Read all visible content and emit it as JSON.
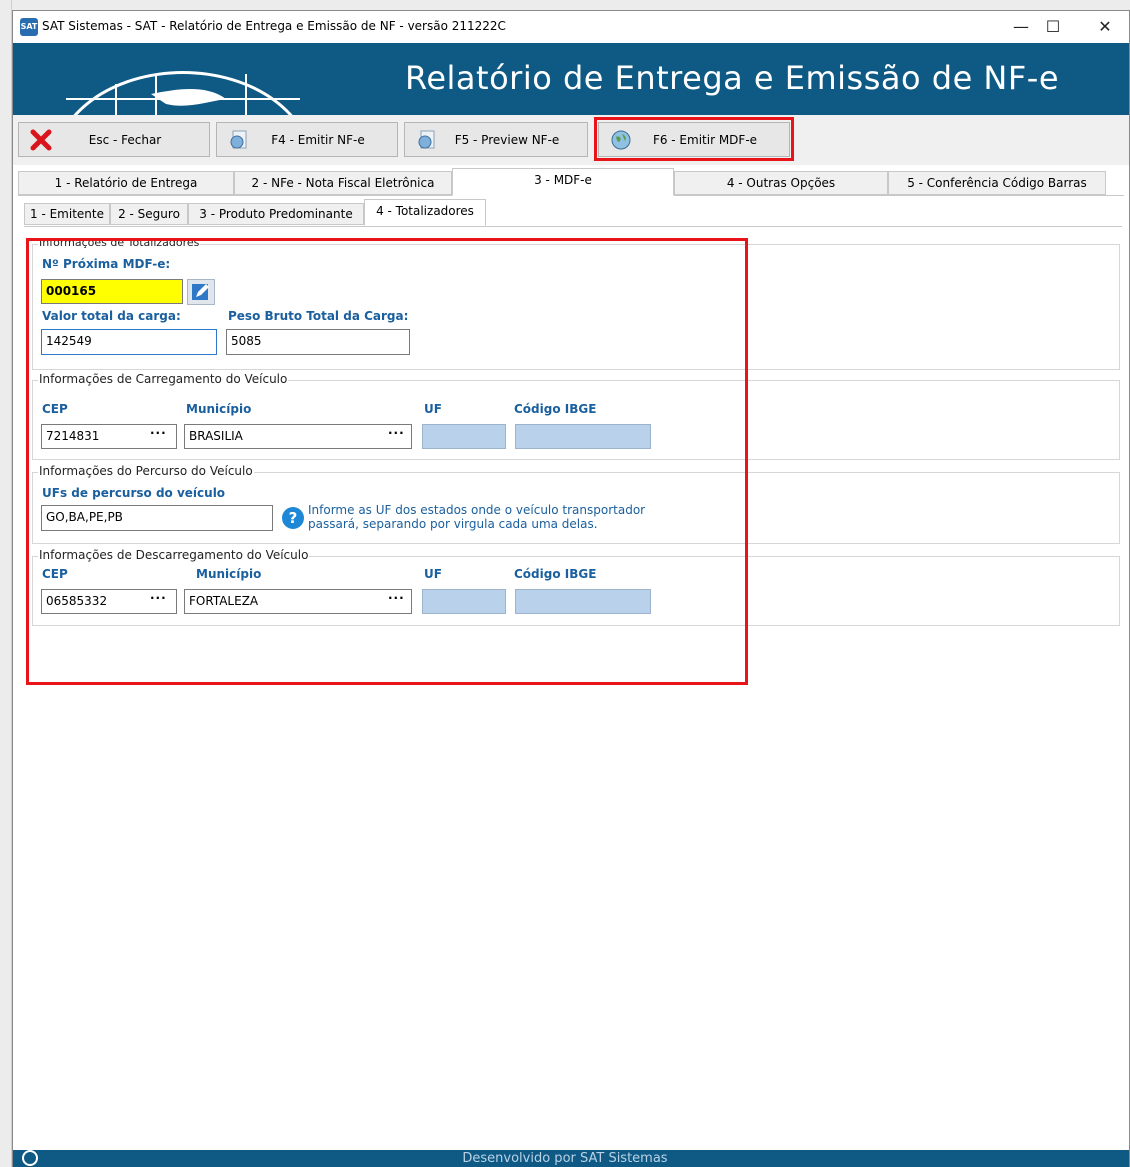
{
  "window": {
    "title": "SAT Sistemas - SAT - Relatório de Entrega e Emissão de NF - versão 211222C",
    "app_icon": "SAT"
  },
  "banner": {
    "title": "Relatório de Entrega e Emissão de NF-e"
  },
  "toolbar": {
    "close_label": "Esc - Fechar",
    "emit_nfe_label": "F4 - Emitir NF-e",
    "preview_nfe_label": "F5 - Preview NF-e",
    "emit_mdfe_label": "F6 - Emitir MDF-e"
  },
  "tabs": [
    "1 - Relatório de Entrega",
    "2 - NFe - Nota Fiscal Eletrônica",
    "3 - MDF-e",
    "4 - Outras Opções",
    "5 - Conferência Código Barras"
  ],
  "subtabs": [
    "1 - Emitente",
    "2 - Seguro",
    "3 - Produto Predominante",
    "4 - Totalizadores"
  ],
  "totalizadores": {
    "legend": "Informações de Totalizadores",
    "next_mdfe_label": "Nº Próxima MDF-e:",
    "next_mdfe_value": "000165",
    "valor_total_label": "Valor total da carga:",
    "valor_total_value": "142549",
    "peso_bruto_label": "Peso Bruto Total da Carga:",
    "peso_bruto_value": "5085"
  },
  "carregamento": {
    "legend": "Informações de Carregamento do Veículo",
    "cep_label": "CEP",
    "cep_value": "7214831",
    "municipio_label": "Município",
    "municipio_value": "BRASILIA",
    "uf_label": "UF",
    "uf_value": "",
    "ibge_label": "Código IBGE",
    "ibge_value": ""
  },
  "percurso": {
    "legend": "Informações do Percurso do Veículo",
    "ufs_label": "UFs de percurso do veículo",
    "ufs_value": "GO,BA,PE,PB",
    "help_line1": "Informe as UF dos estados onde o veículo transportador",
    "help_line2": "passará, separando por virgula cada uma delas."
  },
  "descarregamento": {
    "legend": "Informações de Descarregamento do Veículo",
    "cep_label": "CEP",
    "cep_value": "06585332",
    "municipio_label": "Município",
    "municipio_value": "FORTALEZA",
    "uf_label": "UF",
    "uf_value": "",
    "ibge_label": "Código IBGE",
    "ibge_value": ""
  },
  "ellipsis": "···",
  "footer": {
    "text": "Desenvolvido por SAT Sistemas"
  },
  "colors": {
    "banner": "#0f5a85",
    "highlight": "#e8141a",
    "label_blue": "#1a5f9e",
    "field_blue": "#b9d1ea",
    "field_yellow": "#ffff00"
  }
}
